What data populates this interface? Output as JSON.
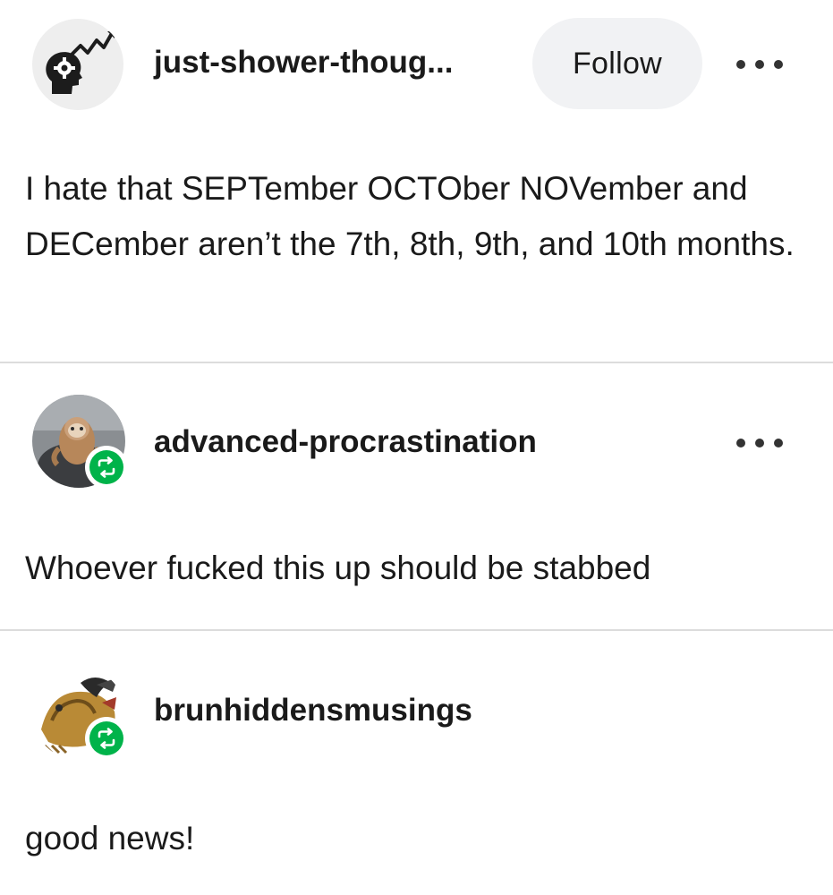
{
  "posts": [
    {
      "username": "just-shower-thoug...",
      "follow_label": "Follow",
      "text": "I hate that SEPTember OCTOber NOVember and DECember aren’t the 7th, 8th, 9th, and 10th months.",
      "avatar": "brain-gear-trend-icon"
    },
    {
      "username": "advanced-procrastination",
      "text": "Whoever fucked this up should be stabbed",
      "avatar": "sloth-photo",
      "badge": "reblog-icon"
    },
    {
      "username": "brunhiddensmusings",
      "text": "good news!",
      "avatar": "griffin-illustration",
      "badge": "reblog-icon"
    }
  ],
  "colors": {
    "reblog_green": "#00b34a",
    "follow_bg": "#f1f2f4",
    "divider": "#dcdcdc",
    "text": "#1a1a1a"
  }
}
